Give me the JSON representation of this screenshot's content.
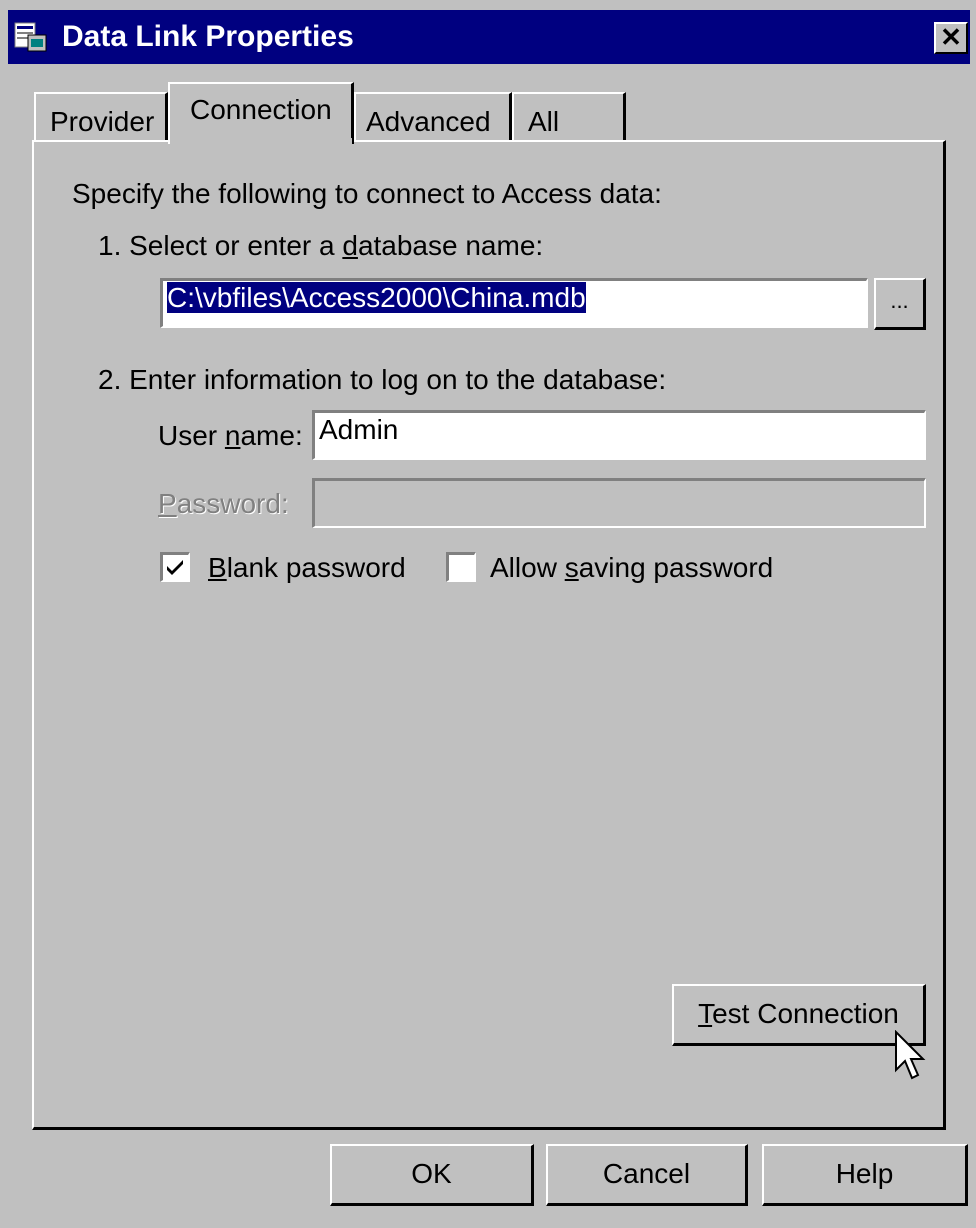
{
  "window": {
    "title": "Data Link Properties",
    "close_label": "✕"
  },
  "tabs": [
    {
      "label": "Provider",
      "active": false
    },
    {
      "label": "Connection",
      "active": true
    },
    {
      "label": "Advanced",
      "active": false
    },
    {
      "label": "All",
      "active": false
    }
  ],
  "connection": {
    "intro": "Specify the following to connect to Access data:",
    "step1": {
      "prefix": "1. Select or enter a ",
      "underlined": "d",
      "suffix": "atabase name:"
    },
    "database_value": "C:\\vbfiles\\Access2000\\China.mdb",
    "browse_label": "...",
    "step2": "2. Enter information to log on to the database:",
    "username_label": {
      "prefix": "User ",
      "underlined": "n",
      "suffix": "ame:"
    },
    "username_value": "Admin",
    "password_label": {
      "underlined": "P",
      "suffix": "assword:"
    },
    "password_value": "",
    "blank_password": {
      "underlined": "B",
      "suffix": "lank password",
      "checked": true
    },
    "allow_saving": {
      "prefix": "Allow ",
      "underlined": "s",
      "suffix": "aving password",
      "checked": false
    },
    "test_connection": {
      "underlined": "T",
      "suffix": "est Connection"
    }
  },
  "footer": {
    "ok_label": "OK",
    "cancel_label": "Cancel",
    "help_label": "Help"
  }
}
